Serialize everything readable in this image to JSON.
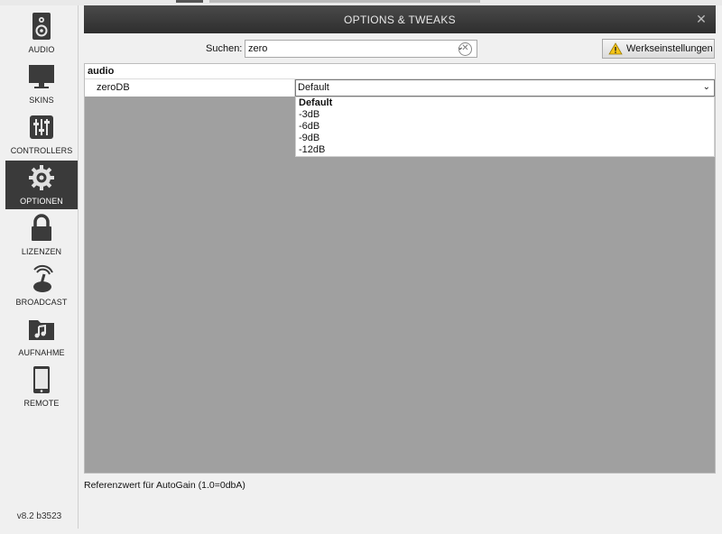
{
  "window": {
    "title": "OPTIONS & TWEAKS",
    "close_glyph": "✕"
  },
  "sidebar": {
    "items": [
      {
        "label": "AUDIO",
        "icon": "speaker-icon"
      },
      {
        "label": "SKINS",
        "icon": "monitor-icon"
      },
      {
        "label": "CONTROLLERS",
        "icon": "sliders-icon"
      },
      {
        "label": "OPTIONEN",
        "icon": "gear-icon",
        "active": true
      },
      {
        "label": "LIZENZEN",
        "icon": "lock-icon"
      },
      {
        "label": "BROADCAST",
        "icon": "broadcast-icon"
      },
      {
        "label": "AUFNAHME",
        "icon": "music-folder-icon"
      },
      {
        "label": "REMOTE",
        "icon": "tablet-icon"
      }
    ],
    "version": "v8.2 b3523"
  },
  "search": {
    "label": "Suchen:",
    "value": "zero",
    "chevron": "⌄",
    "clear_glyph": "✕"
  },
  "reset_button": {
    "label": "Werkseinstellungen",
    "icon": "warning-icon"
  },
  "options": {
    "section": "audio",
    "rows": [
      {
        "name": "zeroDB",
        "value": "Default",
        "chevron": "⌄"
      }
    ],
    "dropdown": [
      "Default",
      "-3dB",
      "-6dB",
      "-9dB",
      "-12dB"
    ]
  },
  "description": "Referenzwert für AutoGain (1.0=0dbA)",
  "colors": {
    "active_nav_bg": "#3a3a3a",
    "titlebar_bg": "#2e2e2e",
    "content_bg": "#a0a0a0",
    "warning": "#f5c518"
  }
}
